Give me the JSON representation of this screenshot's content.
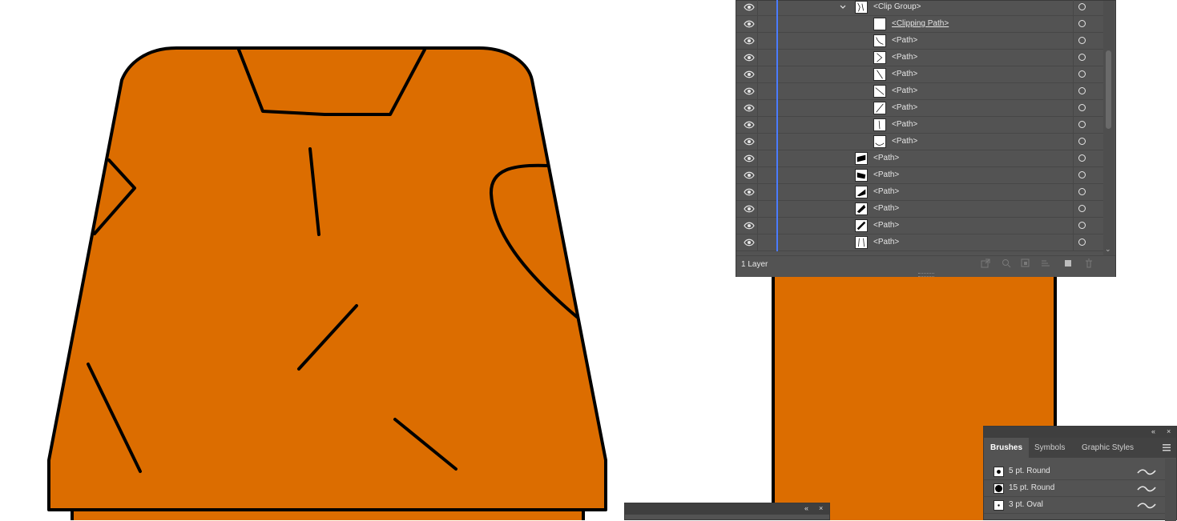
{
  "colors": {
    "artwork_fill": "#dc6d00",
    "artwork_stroke": "#000000",
    "panel_bg": "#535353",
    "layer_accent": "#4a7bff"
  },
  "layers_panel": {
    "rows": [
      {
        "label": "<Clip Group>",
        "indent": "group",
        "expanded": true,
        "thumb": "clipgroup"
      },
      {
        "label": "<Clipping Path>",
        "indent": "child",
        "clipping": true,
        "thumb": "blank"
      },
      {
        "label": "<Path>",
        "indent": "child",
        "thumb": "curve"
      },
      {
        "label": "<Path>",
        "indent": "child",
        "thumb": "chevron"
      },
      {
        "label": "<Path>",
        "indent": "child",
        "thumb": "diag-a"
      },
      {
        "label": "<Path>",
        "indent": "child",
        "thumb": "diag-b"
      },
      {
        "label": "<Path>",
        "indent": "child",
        "thumb": "diag-c"
      },
      {
        "label": "<Path>",
        "indent": "child",
        "thumb": "vline"
      },
      {
        "label": "<Path>",
        "indent": "child",
        "thumb": "arc"
      },
      {
        "label": "<Path>",
        "indent": "group",
        "thumb": "block1"
      },
      {
        "label": "<Path>",
        "indent": "group",
        "thumb": "block2"
      },
      {
        "label": "<Path>",
        "indent": "group",
        "thumb": "block3"
      },
      {
        "label": "<Path>",
        "indent": "group",
        "thumb": "block4"
      },
      {
        "label": "<Path>",
        "indent": "group",
        "thumb": "block5"
      },
      {
        "label": "<Path>",
        "indent": "group",
        "thumb": "lines"
      }
    ],
    "footer_count": "1 Layer",
    "footer_icons": [
      "collect-export-icon",
      "locate-object-icon",
      "make-clipping-mask-icon",
      "create-sublayer-icon",
      "new-layer-icon",
      "delete-icon"
    ]
  },
  "brushes_panel": {
    "tabs": [
      "Brushes",
      "Symbols",
      "Graphic Styles"
    ],
    "active_tab": "Brushes",
    "brushes": [
      {
        "label": "5 pt. Round",
        "dot": "small"
      },
      {
        "label": "15 pt. Round",
        "dot": "large"
      },
      {
        "label": "3 pt. Oval",
        "dot": "tiny"
      }
    ],
    "collapse_icon": "«",
    "close_icon": "×"
  },
  "mini_panel": {
    "collapse_icon": "«",
    "close_icon": "×"
  }
}
